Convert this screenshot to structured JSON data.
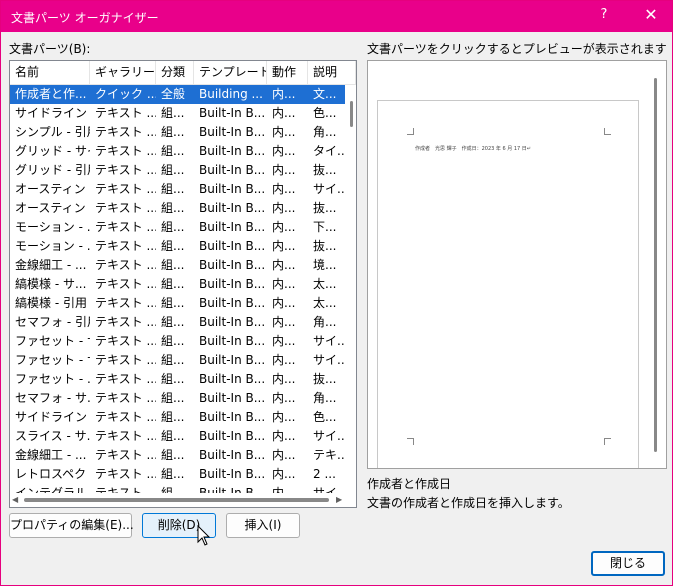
{
  "window": {
    "title": "文書パーツ オーガナイザー",
    "help_glyph": "?",
    "close_glyph": "✕"
  },
  "list": {
    "label": "文書パーツ(B):",
    "columns": [
      "名前",
      "ギャラリー",
      "分類",
      "テンプレート",
      "動作",
      "説明"
    ],
    "selected_index": 0,
    "rows": [
      [
        "作成者と作...",
        "クイック ...",
        "全般",
        "Building ...",
        "内...",
        "文..."
      ],
      [
        "サイドライン -...",
        "テキスト ...",
        "組...",
        "Built-In B...",
        "内...",
        "色..."
      ],
      [
        "シンプル - 引用",
        "テキスト ...",
        "組...",
        "Built-In B...",
        "内...",
        "角..."
      ],
      [
        "グリッド - サイ...",
        "テキスト ...",
        "組...",
        "Built-In B...",
        "内...",
        "タイ..."
      ],
      [
        "グリッド - 引用",
        "テキスト ...",
        "組...",
        "Built-In B...",
        "内...",
        "抜..."
      ],
      [
        "オースティン - ...",
        "テキスト ...",
        "組...",
        "Built-In B...",
        "内...",
        "サイ..."
      ],
      [
        "オースティン - ...",
        "テキスト ...",
        "組...",
        "Built-In B...",
        "内...",
        "抜..."
      ],
      [
        "モーション - ...",
        "テキスト ...",
        "組...",
        "Built-In B...",
        "内...",
        "下..."
      ],
      [
        "モーション - ...",
        "テキスト ...",
        "組...",
        "Built-In B...",
        "内...",
        "抜..."
      ],
      [
        "金線細工 - ...",
        "テキスト ...",
        "組...",
        "Built-In B...",
        "内...",
        "境..."
      ],
      [
        "縞模様 - サ...",
        "テキスト ...",
        "組...",
        "Built-In B...",
        "内...",
        "太..."
      ],
      [
        "縞模様 - 引用",
        "テキスト ...",
        "組...",
        "Built-In B...",
        "内...",
        "太..."
      ],
      [
        "セマフォ - 引用",
        "テキスト ...",
        "組...",
        "Built-In B...",
        "内...",
        "角..."
      ],
      [
        "ファセット - サ...",
        "テキスト ...",
        "組...",
        "Built-In B...",
        "内...",
        "サイ..."
      ],
      [
        "ファセット - サ...",
        "テキスト ...",
        "組...",
        "Built-In B...",
        "内...",
        "サイ..."
      ],
      [
        "ファセット - ...",
        "テキスト ...",
        "組...",
        "Built-In B...",
        "内...",
        "抜..."
      ],
      [
        "セマフォ - サ...",
        "テキスト ...",
        "組...",
        "Built-In B...",
        "内...",
        "角..."
      ],
      [
        "サイドライン -...",
        "テキスト ...",
        "組...",
        "Built-In B...",
        "内...",
        "色..."
      ],
      [
        "スライス - サ...",
        "テキスト ...",
        "組...",
        "Built-In B...",
        "内...",
        "サイ..."
      ],
      [
        "金線細工 - ...",
        "テキスト ...",
        "組...",
        "Built-In B...",
        "内...",
        "テキ..."
      ],
      [
        "レトロスペクト...",
        "テキスト ...",
        "組...",
        "Built-In B...",
        "内...",
        "2 ..."
      ],
      [
        "インテグラル ...",
        "テキスト ...",
        "組...",
        "Built-In B...",
        "内...",
        "サイ..."
      ]
    ]
  },
  "preview": {
    "hint": "文書パーツをクリックするとプレビューが表示されます",
    "page_text": "作成者　光思 輝子　作成日：2023 年 6 月 17 日↵",
    "part_name": "作成者と作成日",
    "part_description": "文書の作成者と作成日を挿入します。"
  },
  "buttons": {
    "properties": "プロパティの編集(E)...",
    "delete": "削除(D)",
    "insert": "挿入(I)",
    "close": "閉じる"
  },
  "colors": {
    "titlebar": "#e9008a",
    "selection": "#1e6fd3"
  }
}
